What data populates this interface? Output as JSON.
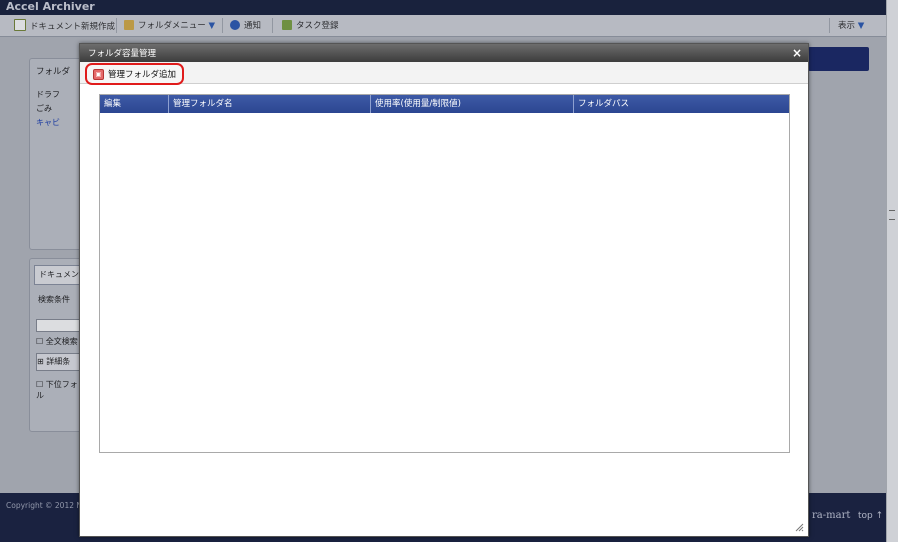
{
  "app": {
    "title": "Accel Archiver"
  },
  "toolbar": {
    "new_document": "ドキュメント新規作成",
    "folder_menu": "フォルダメニュー",
    "notice": "通知",
    "task_register": "タスク登録",
    "view": "表示"
  },
  "left_panel": {
    "folder_title": "フォルダ",
    "tree_items": [
      "ドラフ",
      "ごみ",
      "キャビ"
    ],
    "doc_tab": "ドキュメン",
    "search_conditions": "検索条件",
    "fulltext_search": "全文検索",
    "detail_search": "詳細条",
    "sub_folder": "下位フォル"
  },
  "footer": {
    "copyright": "Copyright © 2012 NT",
    "brand": "ra-mart",
    "top_link": "top ↑"
  },
  "dialog": {
    "title": "フォルダ容量管理",
    "close": "×",
    "add_button": "管理フォルダ追加",
    "columns": [
      "編集",
      "管理フォルダ名",
      "使用率(使用量/制限値)",
      "フォルダパス"
    ],
    "rows": []
  },
  "colors": {
    "header_blue": "#2c4691",
    "highlight_red": "#e01b1b",
    "title_dark": "#1b2440"
  }
}
